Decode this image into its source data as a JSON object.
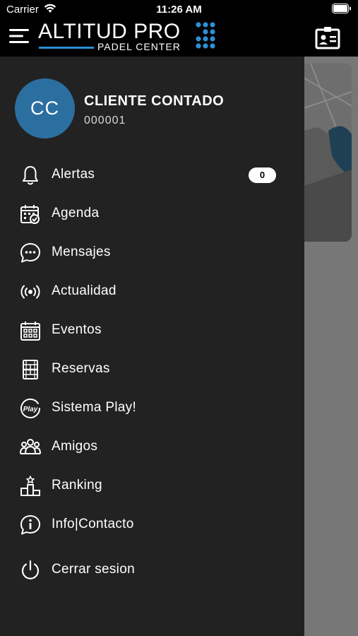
{
  "status_bar": {
    "carrier": "Carrier",
    "time": "11:26 AM"
  },
  "header": {
    "logo_main": "ALTITUD PRO",
    "logo_sub": "PADEL CENTER",
    "accent_color": "#2d8fd4"
  },
  "user": {
    "initials": "CC",
    "name": "CLIENTE CONTADO",
    "id": "000001"
  },
  "menu": [
    {
      "label": "Alertas",
      "icon": "bell-icon",
      "badge": "0"
    },
    {
      "label": "Agenda",
      "icon": "calendar-check-icon"
    },
    {
      "label": "Mensajes",
      "icon": "chat-bubble-icon"
    },
    {
      "label": "Actualidad",
      "icon": "broadcast-icon"
    },
    {
      "label": "Eventos",
      "icon": "calendar-grid-icon"
    },
    {
      "label": "Reservas",
      "icon": "court-icon"
    },
    {
      "label": "Sistema Play!",
      "icon": "play-badge-icon"
    },
    {
      "label": "Amigos",
      "icon": "friends-icon"
    },
    {
      "label": "Ranking",
      "icon": "podium-icon"
    },
    {
      "label": "Info|Contacto",
      "icon": "info-chat-icon"
    },
    {
      "label": "Cerrar sesion",
      "icon": "power-icon"
    }
  ]
}
